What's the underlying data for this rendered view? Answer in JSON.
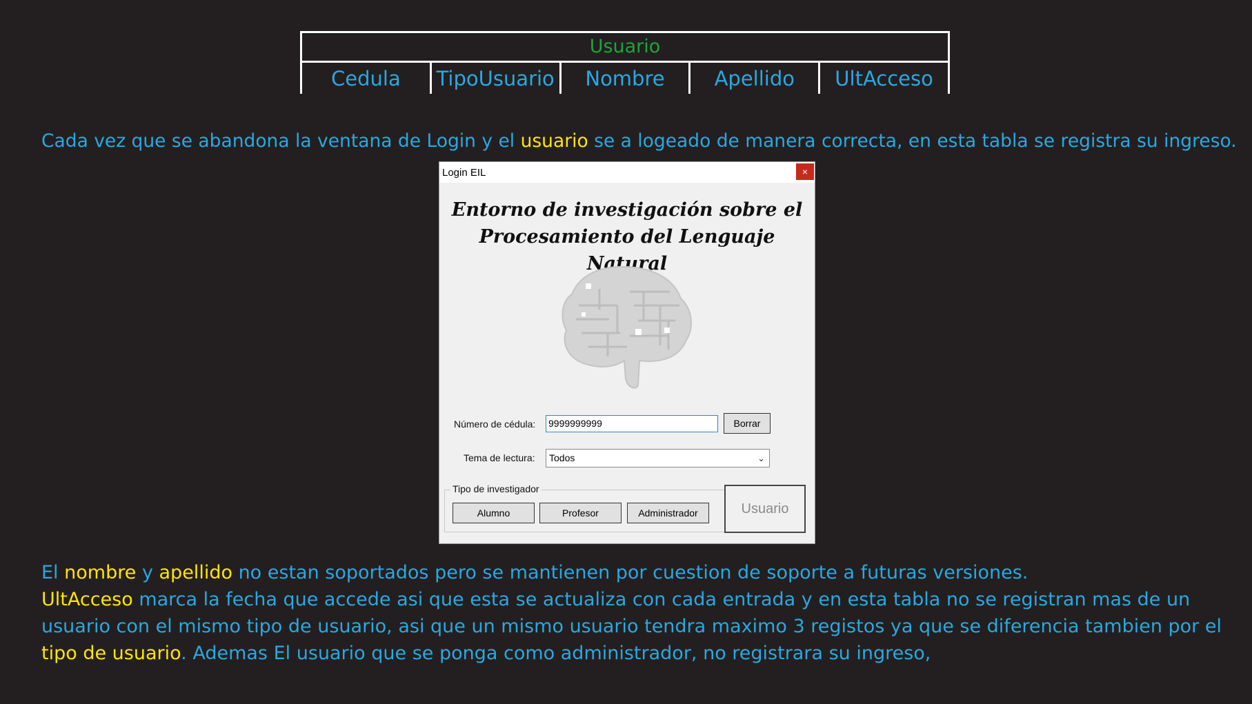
{
  "schema": {
    "title": "Usuario",
    "columns": [
      "Cedula",
      "TipoUsuario",
      "Nombre",
      "Apellido",
      "UltAcceso"
    ]
  },
  "para1": {
    "before": "Cada vez que se abandona la ventana de Login y el ",
    "highlight": "usuario",
    "after": " se a logeado de manera correcta, en esta tabla se registra su ingreso."
  },
  "login_window": {
    "title": "Login EIL",
    "close_glyph": "×",
    "heading_line1": "Entorno de investigación sobre el",
    "heading_line2": "Procesamiento del Lenguaje Natural",
    "cedula_label": "Número de cédula:",
    "cedula_value": "9999999999",
    "borrar_label": "Borrar",
    "tema_label": "Tema de lectura:",
    "tema_value": "Todos",
    "group_label": "Tipo de investigador",
    "alumno_label": "Alumno",
    "profesor_label": "Profesor",
    "administrador_label": "Administrador",
    "usuario_button_label": "Usuario",
    "icons": {
      "close": "close-icon",
      "dropdown": "chevron-down-icon",
      "logo": "brain-circuit-icon"
    }
  },
  "para2": {
    "s1": "El ",
    "h1": "nombre",
    "s2": " y ",
    "h2": "apellido",
    "s3": " no estan soportados pero se mantienen por cuestion de soporte a futuras versiones.",
    "h3": "UltAcceso",
    "s4": " marca la fecha que accede asi que esta se actualiza con cada entrada y en esta tabla no se registran mas de un usuario con el mismo tipo de usuario, asi que un mismo usuario tendra maximo 3 registos ya que se diferencia tambien por el ",
    "h4": "tipo de usuario",
    "s5": ". Ademas El usuario que se ponga como administrador, no registrara su ingreso,"
  },
  "colors": {
    "background": "#231f20",
    "text_blue": "#2aa8e0",
    "highlight_yellow": "#ffe600",
    "title_green": "#1fa33a",
    "border_white": "#ffffff"
  }
}
